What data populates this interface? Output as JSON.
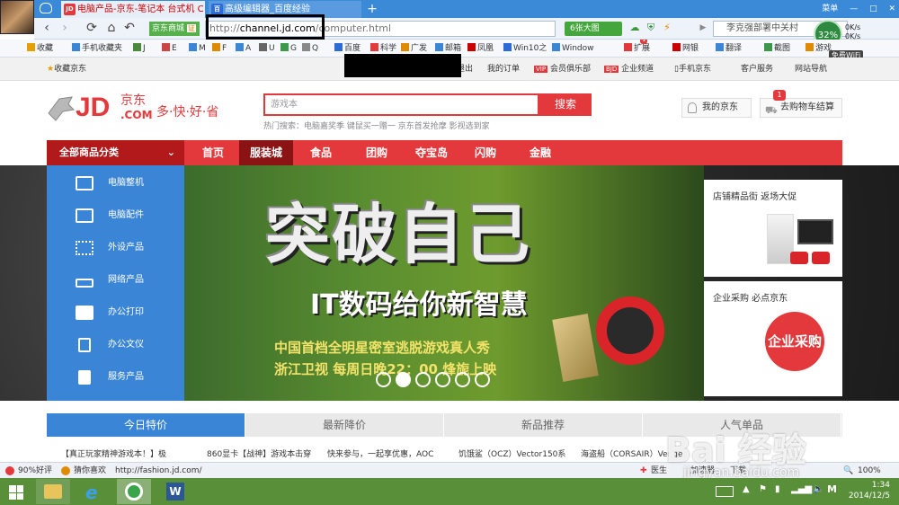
{
  "tabs": [
    {
      "label": "电脑产品-京东-笔记本 台式机 C",
      "icon_text": "JD"
    },
    {
      "label": "高级编辑器_百度经验",
      "icon_text": "百"
    }
  ],
  "new_tab": "+",
  "window_controls": [
    "菜单",
    "—",
    "□",
    "✕"
  ],
  "address": {
    "scope_label": "京东商城",
    "scope_badge": "证",
    "url_prefix": "http://",
    "url_host": "channel.jd.com",
    "url_path": "/computer.html",
    "big_image": "6张大图",
    "search_text": "李克强部署中关村"
  },
  "net_widget": {
    "percent": "32%",
    "up": "0K/s",
    "down": "0K/s",
    "wifi": "免费WiFi"
  },
  "bookmarks": [
    "收藏",
    "手机收藏夹",
    "J",
    "E",
    "M",
    "F",
    "A",
    "U",
    "G",
    "Q",
    "百度",
    "科学",
    "广发",
    "邮箱",
    "凤凰",
    "Win10之",
    "Window",
    "扩展",
    "网银",
    "翻译",
    "截图",
    "游戏"
  ],
  "bookmark_badge": "1",
  "jd_top": {
    "fav": "收藏京东",
    "links": [
      "退出",
      "我的订单",
      "会员俱乐部",
      "企业频道",
      "手机京东",
      "客户服务",
      "网站导航"
    ],
    "vip": "VIP",
    "bjd": "BJD"
  },
  "jd_header": {
    "logo_jd": "JD",
    "logo_cn": "京东",
    "logo_com": ".COM",
    "slogan": "多·快·好·省",
    "search_placeholder": "游戏本",
    "search_button": "搜索",
    "hot_words": "热门搜索：电脑嘉奖季   键鼠买一赠一   京东首发抢摩   影视选到家",
    "my_jd": "我的京东",
    "cart": "去购物车结算",
    "cart_count": "1"
  },
  "nav": {
    "all": "全部商品分类",
    "items": [
      "首页",
      "服装城",
      "食品",
      "团购",
      "夺宝岛",
      "闪购",
      "金融"
    ]
  },
  "categories": [
    "电脑整机",
    "电脑配件",
    "外设产品",
    "网络产品",
    "办公打印",
    "办公文仪",
    "服务产品"
  ],
  "banner": {
    "title": "突破自己",
    "subtitle": "IT数码给你新智慧",
    "line1": "中国首档全明星密室逃脱游戏真人秀",
    "line2": "浙江卫视  每周日晚22：00 烽旎上映",
    "slides": 6,
    "active_slide": 2
  },
  "side_ads": [
    {
      "title": "店铺精品街  返场大促"
    },
    {
      "title": "企业采购  必点京东",
      "badge": "企业采购"
    }
  ],
  "home_tabs": [
    "今日特价",
    "最新降价",
    "新品推荐",
    "人气单品"
  ],
  "news": [
    "【真正玩家精神游戏本！】极",
    "860显卡【战神】游戏本击穿",
    "快来参与，一起享优惠，AOC",
    "饥饿鲨（OCZ）Vector150系",
    "海盗船（CORSAIR）Venge"
  ],
  "watermark": "Bai 经验",
  "watermark_url": "jingyan.baidu.com",
  "status": {
    "rating": "90%好评",
    "guess": "猜你喜欢",
    "url": "http://fashion.jd.com/",
    "doctor": "医生",
    "accel": "加速器",
    "download": "下载",
    "zoom": "100%"
  },
  "taskbar": {
    "time": "1:34",
    "date": "2014/12/5"
  }
}
